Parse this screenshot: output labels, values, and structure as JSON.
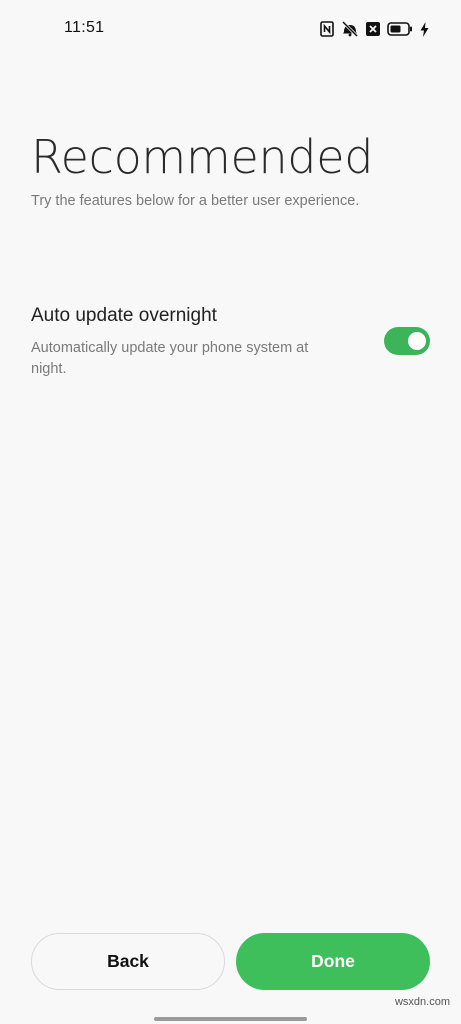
{
  "status_bar": {
    "time": "11:51",
    "icons": [
      "nfc-icon",
      "vibrate-mute-icon",
      "notification-icon",
      "battery-icon",
      "charging-icon"
    ]
  },
  "page": {
    "title": "Recommended",
    "subtitle": "Try the features below for a better user experience."
  },
  "features": [
    {
      "title": "Auto update overnight",
      "description": "Automatically update your phone system at night.",
      "enabled": true
    }
  ],
  "buttons": {
    "back_label": "Back",
    "done_label": "Done"
  },
  "watermark": "wsxdn.com",
  "colors": {
    "accent": "#3fbe5c",
    "toggle_on": "#3cb55a",
    "background": "#f8f8f8"
  }
}
